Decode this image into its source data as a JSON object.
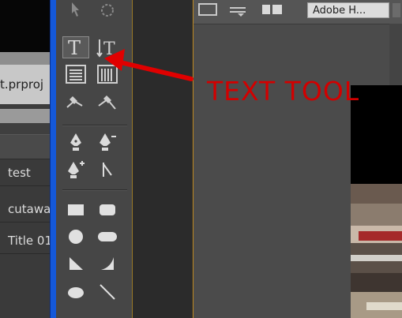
{
  "project_panel": {
    "filename": "t.prproj",
    "items": [
      "test",
      "cutaway",
      "Title 01"
    ]
  },
  "tools": {
    "icons": [
      "selection-icon",
      "rotation-icon",
      "type-tool-icon",
      "vertical-type-tool-icon",
      "area-type-tool-icon",
      "vertical-area-type-tool-icon",
      "path-type-tool-icon",
      "vertical-path-type-tool-icon",
      "pen-tool-icon",
      "delete-anchor-point-icon",
      "add-anchor-point-icon",
      "convert-anchor-point-icon",
      "rectangle-tool-icon",
      "rounded-rectangle-tool-icon",
      "ellipse-tool-icon",
      "rounded-corner-rectangle-icon",
      "wedge-tool-icon",
      "arc-tool-icon",
      "oval-tool-icon",
      "line-tool-icon"
    ]
  },
  "main": {
    "font_select": "Adobe H..."
  },
  "annotation": {
    "text": "TEXT TOOL",
    "color": "#d20000"
  }
}
